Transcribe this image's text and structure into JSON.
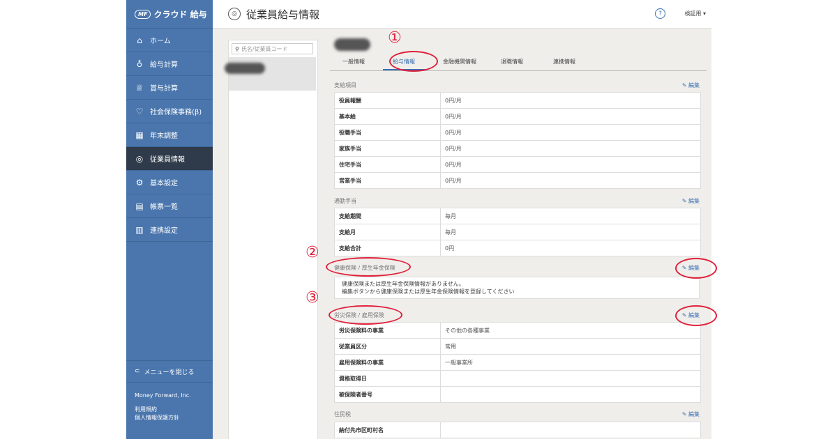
{
  "app": {
    "logo_mark": "MF",
    "logo_text": "クラウド 給与"
  },
  "sidebar": {
    "items": [
      {
        "label": "ホーム",
        "icon": "home-icon"
      },
      {
        "label": "給与計算",
        "icon": "money-bag-icon"
      },
      {
        "label": "賞与計算",
        "icon": "trophy-icon"
      },
      {
        "label": "社会保険事務(β)",
        "icon": "heart-icon"
      },
      {
        "label": "年末調整",
        "icon": "calculator-icon"
      },
      {
        "label": "従業員情報",
        "icon": "employee-icon",
        "active": true
      },
      {
        "label": "基本設定",
        "icon": "gear-icon"
      },
      {
        "label": "帳票一覧",
        "icon": "document-icon"
      },
      {
        "label": "連携設定",
        "icon": "calendar-icon"
      }
    ],
    "collapse_label": "メニューを閉じる",
    "company": "Money Forward, Inc.",
    "terms": "利用規約",
    "privacy": "個人情報保護方針"
  },
  "header": {
    "title": "従業員給与情報",
    "user": "検証用 ▾"
  },
  "search": {
    "placeholder": "氏名/従業員コード"
  },
  "tabs": [
    "一般情報",
    "給与情報",
    "金融機関情報",
    "退職情報",
    "連携情報"
  ],
  "edit_label": "編集",
  "sections": {
    "pay_items": {
      "title": "支給項目",
      "rows": [
        {
          "k": "役員報酬",
          "v": "0円/月"
        },
        {
          "k": "基本給",
          "v": "0円/月"
        },
        {
          "k": "役職手当",
          "v": "0円/月"
        },
        {
          "k": "家族手当",
          "v": "0円/月"
        },
        {
          "k": "住宅手当",
          "v": "0円/月"
        },
        {
          "k": "営業手当",
          "v": "0円/月"
        }
      ]
    },
    "commute": {
      "title": "通勤手当",
      "rows": [
        {
          "k": "支給期間",
          "v": "毎月"
        },
        {
          "k": "支給月",
          "v": "毎月"
        },
        {
          "k": "支給合計",
          "v": "0円"
        }
      ]
    },
    "health": {
      "title": "健康保険 / 厚生年金保険",
      "message_line1": "健康保険または厚生年金保険情報がありません。",
      "message_line2": "編集ボタンから健康保険または厚生年金保険情報を登録してください"
    },
    "labor": {
      "title": "労災保険 / 雇用保険",
      "rows": [
        {
          "k": "労災保険料の事業",
          "v": "その他の各種事業"
        },
        {
          "k": "従業員区分",
          "v": "常用"
        },
        {
          "k": "雇用保険料の事業",
          "v": "一般事業所"
        },
        {
          "k": "資格取得日",
          "v": ""
        },
        {
          "k": "被保険者番号",
          "v": ""
        }
      ]
    },
    "resident": {
      "title": "住民税",
      "rows": [
        {
          "k": "納付先市区町村名",
          "v": ""
        }
      ]
    }
  },
  "annotations": {
    "n1": "①",
    "n2": "②",
    "n3": "③",
    "color": "#e0203a"
  }
}
